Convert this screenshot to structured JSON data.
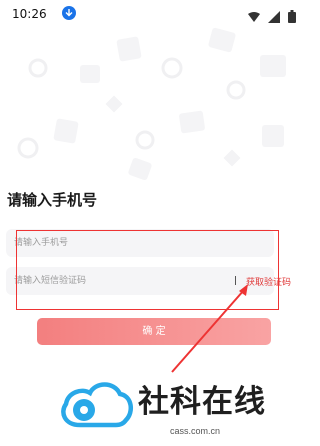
{
  "status_bar": {
    "time": "10:26"
  },
  "login": {
    "heading": "请输入手机号",
    "phone_placeholder": "请输入手机号",
    "code_placeholder": "请输入短信验证码",
    "get_code_label": "获取验证码",
    "confirm_label": "确 定"
  },
  "watermark": {
    "brand": "社科在线",
    "domain": "cass.com.cn"
  },
  "colors": {
    "accent_red": "#e03a3a",
    "button_gradient": [
      "#f37f7f",
      "#f9a3a3"
    ],
    "logo_blue": "#29a8e8"
  }
}
